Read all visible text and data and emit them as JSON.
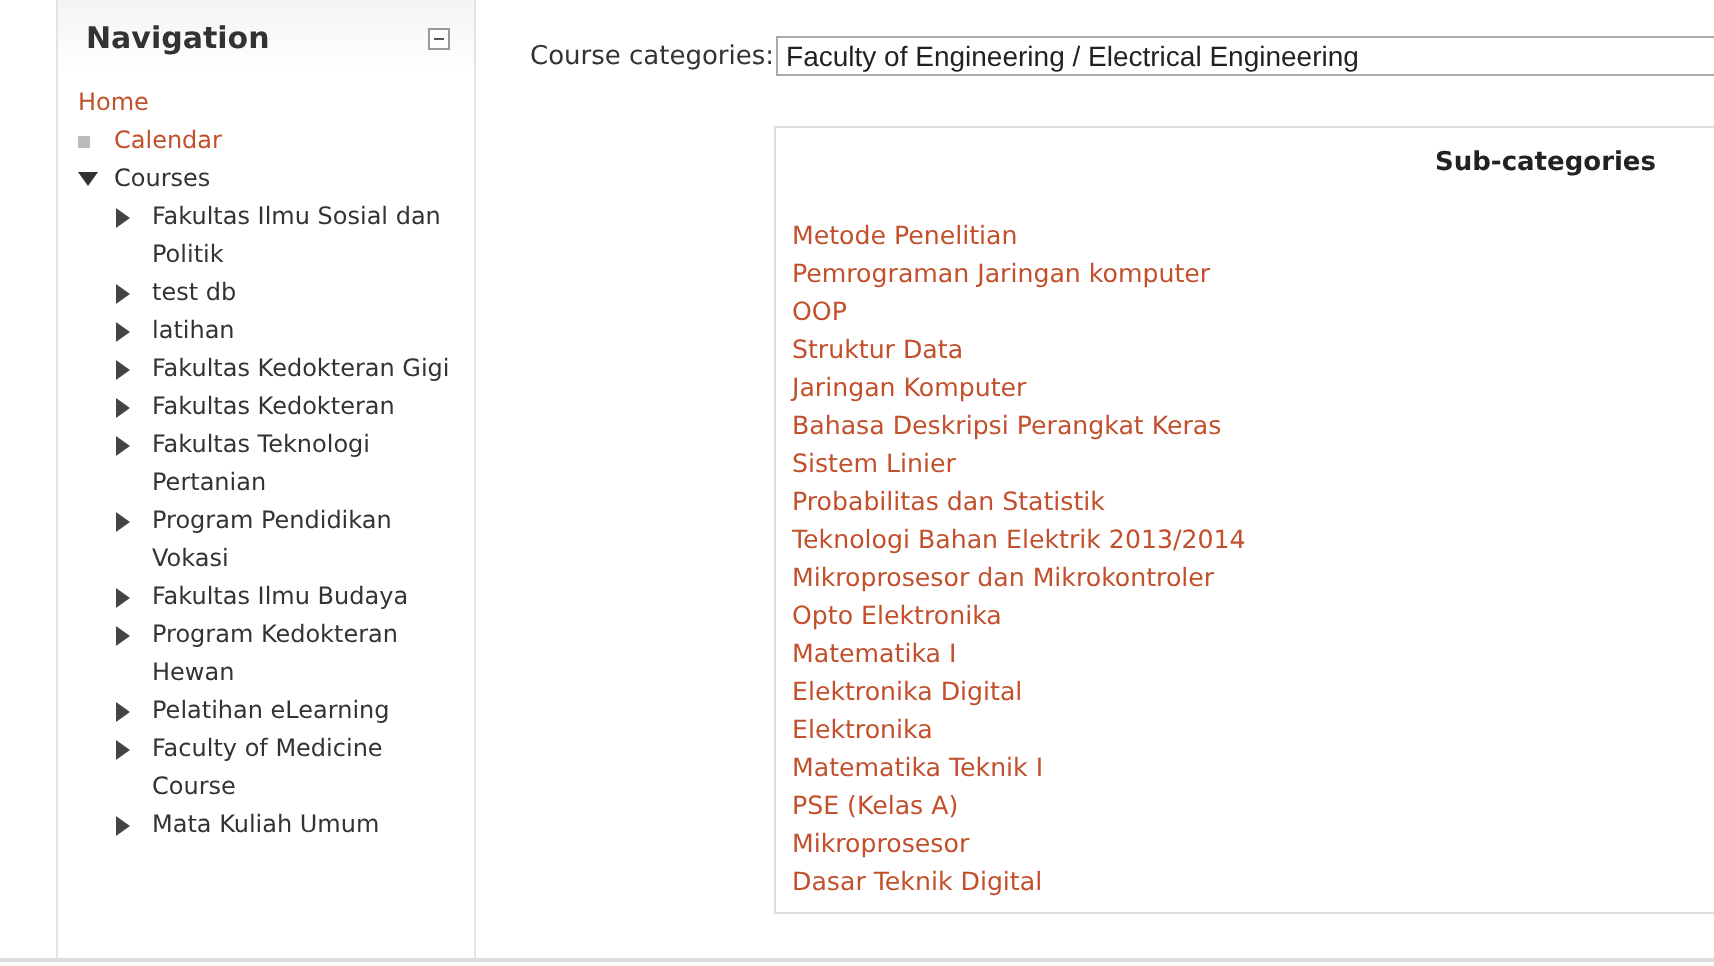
{
  "navigation": {
    "title": "Navigation",
    "items": [
      {
        "label": "Home",
        "kind": "plain"
      },
      {
        "label": "Calendar",
        "kind": "leaf"
      },
      {
        "label": "Courses",
        "kind": "branch",
        "expanded": true,
        "children": [
          {
            "label": "Fakultas Ilmu Sosial dan Politik",
            "kind": "branch",
            "expanded": false
          },
          {
            "label": "test db",
            "kind": "branch",
            "expanded": false
          },
          {
            "label": "latihan",
            "kind": "branch",
            "expanded": false
          },
          {
            "label": "Fakultas Kedokteran Gigi",
            "kind": "branch",
            "expanded": false
          },
          {
            "label": "Fakultas Kedokteran",
            "kind": "branch",
            "expanded": false
          },
          {
            "label": "Fakultas Teknologi Pertanian",
            "kind": "branch",
            "expanded": false
          },
          {
            "label": "Program Pendidikan Vokasi",
            "kind": "branch",
            "expanded": false
          },
          {
            "label": "Fakultas Ilmu Budaya",
            "kind": "branch",
            "expanded": false
          },
          {
            "label": "Program Kedokteran Hewan",
            "kind": "branch",
            "expanded": false
          },
          {
            "label": "Pelatihan eLearning",
            "kind": "branch",
            "expanded": false
          },
          {
            "label": "Faculty of Medicine Course",
            "kind": "branch",
            "expanded": false
          },
          {
            "label": "Mata Kuliah Umum",
            "kind": "branch",
            "expanded": false
          }
        ]
      }
    ]
  },
  "course_categories": {
    "label": "Course categories:",
    "value": "Faculty of Engineering / Electrical Engineering"
  },
  "subcategories": {
    "title": "Sub-categories",
    "items": [
      "Metode Penelitian",
      "Pemrograman Jaringan komputer",
      "OOP",
      "Struktur Data",
      "Jaringan Komputer",
      "Bahasa Deskripsi Perangkat Keras",
      "Sistem Linier",
      "Probabilitas dan Statistik",
      "Teknologi Bahan Elektrik 2013/2014",
      "Mikroprosesor dan Mikrokontroler",
      "Opto Elektronika",
      "Matematika I",
      "Elektronika Digital",
      "Elektronika",
      "Matematika Teknik I",
      "PSE (Kelas A)",
      "Mikroprosesor",
      "Dasar Teknik Digital"
    ]
  }
}
